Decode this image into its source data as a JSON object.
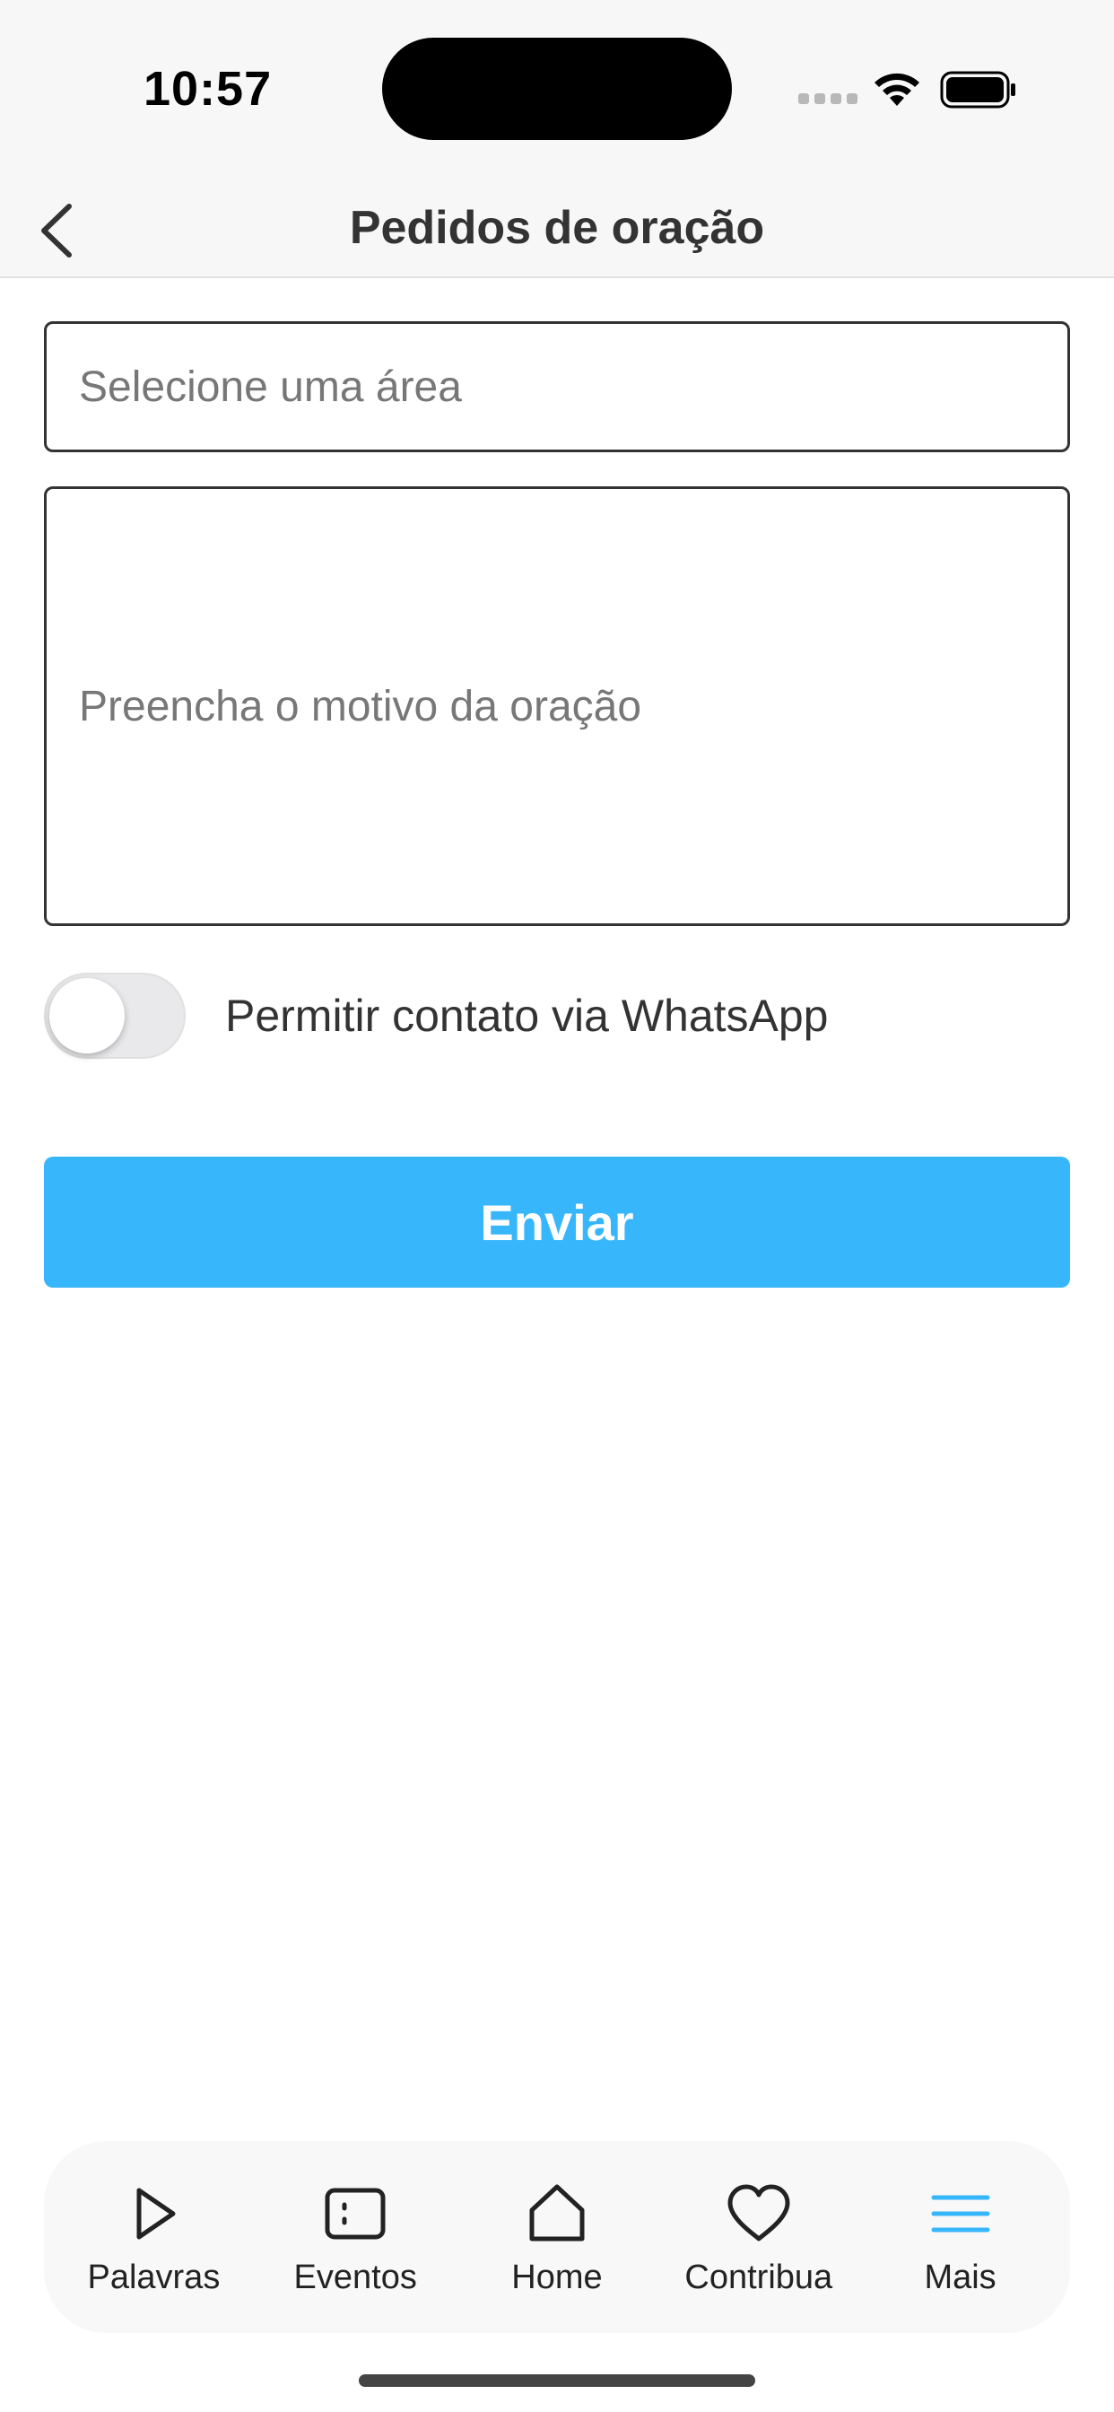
{
  "status_bar": {
    "time": "10:57"
  },
  "header": {
    "title": "Pedidos de oração",
    "back_icon": "chevron-left-icon"
  },
  "form": {
    "area_placeholder": "Selecione uma área",
    "reason_placeholder": "Preencha o motivo da oração",
    "whatsapp_label": "Permitir contato via WhatsApp",
    "whatsapp_enabled": false,
    "submit_label": "Enviar",
    "submit_color": "#38b6fb"
  },
  "tab_bar": {
    "active_color": "#38b6fb",
    "items": [
      {
        "label": "Palavras",
        "icon": "play-icon",
        "active": false
      },
      {
        "label": "Eventos",
        "icon": "calendar-card-icon",
        "active": false
      },
      {
        "label": "Home",
        "icon": "home-icon",
        "active": false
      },
      {
        "label": "Contribua",
        "icon": "heart-icon",
        "active": false
      },
      {
        "label": "Mais",
        "icon": "menu-icon",
        "active": true
      }
    ]
  }
}
